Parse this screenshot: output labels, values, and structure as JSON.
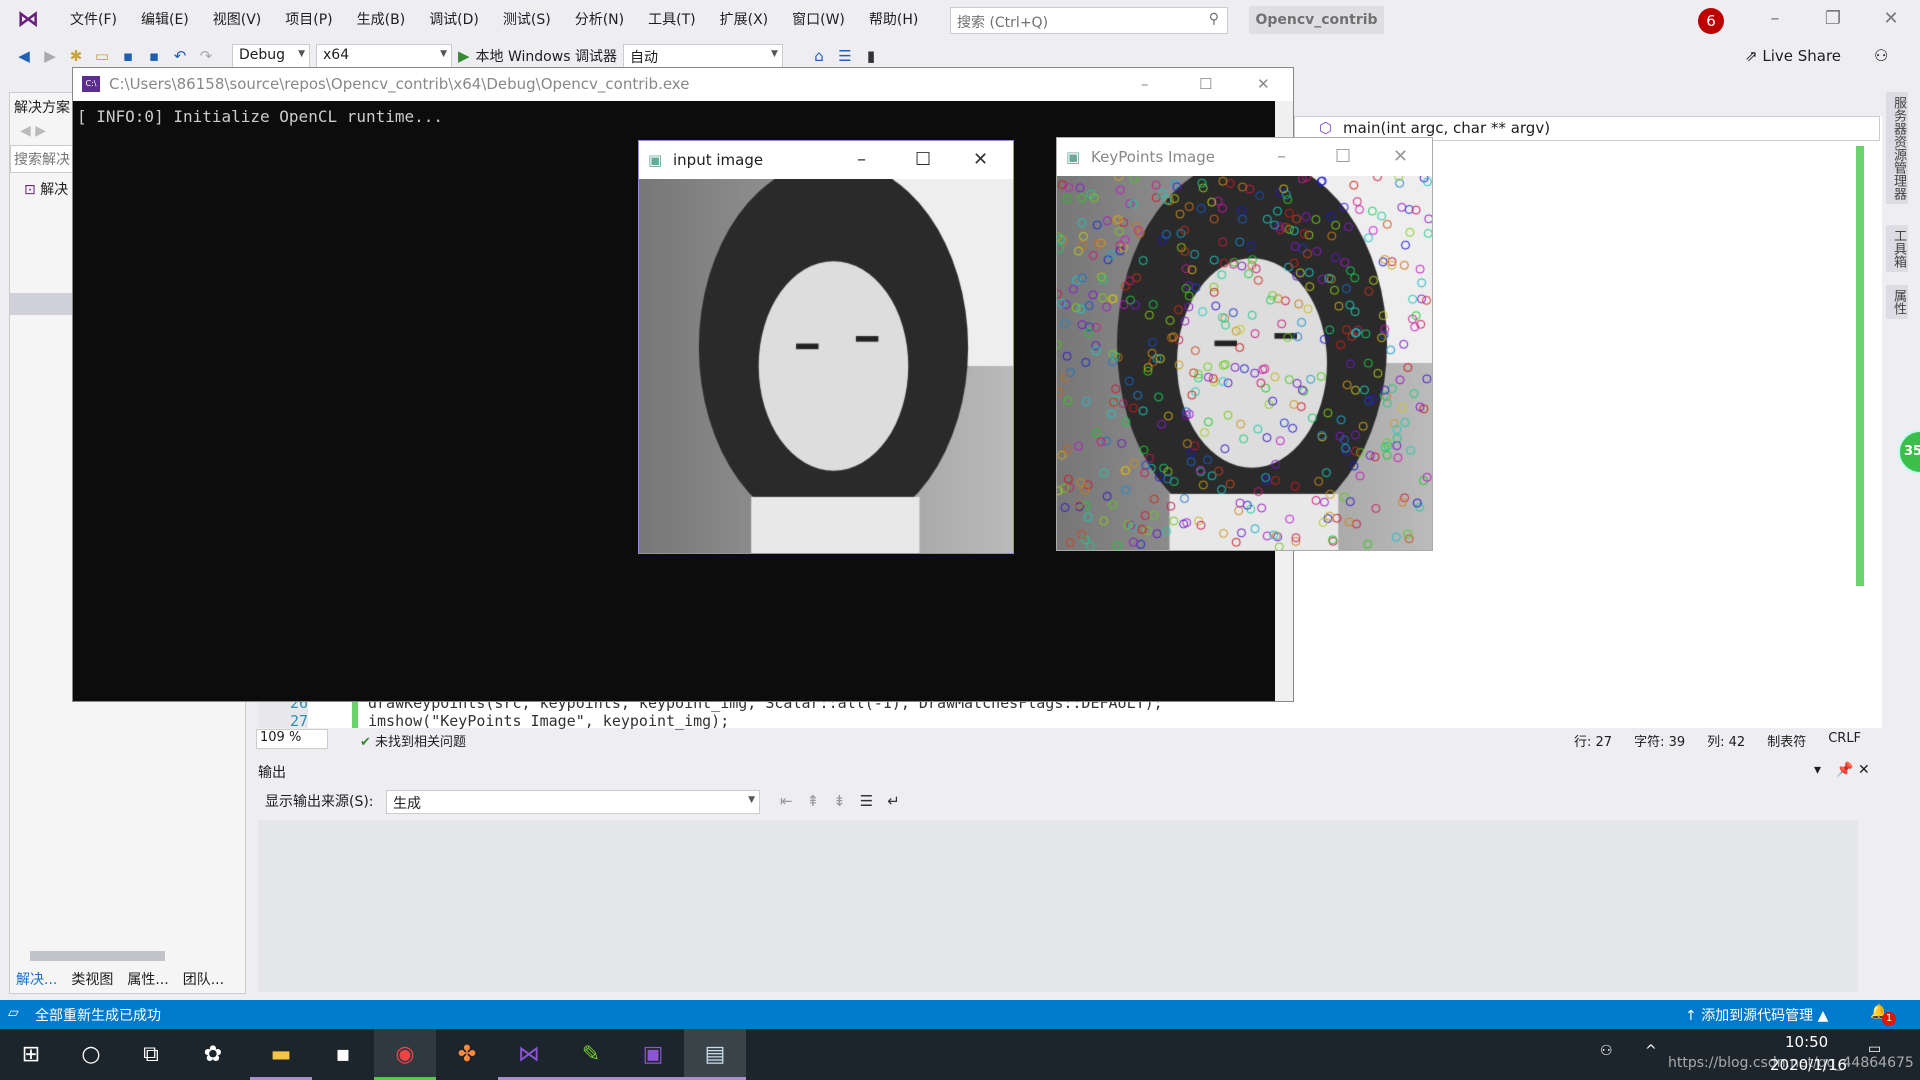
{
  "menubar": {
    "items": [
      "文件(F)",
      "编辑(E)",
      "视图(V)",
      "项目(P)",
      "生成(B)",
      "调试(D)",
      "测试(S)",
      "分析(N)",
      "工具(T)",
      "扩展(X)",
      "窗口(W)",
      "帮助(H)"
    ],
    "search_placeholder": "搜索 (Ctrl+Q)",
    "project_name": "Opencv_contrib",
    "notification_count": "6"
  },
  "toolbar": {
    "config": "Debug",
    "platform": "x64",
    "run_label": "本地 Windows 调试器",
    "auto": "自动",
    "live_share": "Live Share"
  },
  "solution_explorer": {
    "title": "解决方案",
    "search_placeholder": "搜索解决",
    "root": "解决",
    "tabs": [
      "解决...",
      "类视图",
      "属性...",
      "团队..."
    ]
  },
  "console": {
    "title": "C:\\Users\\86158\\source\\repos\\Opencv_contrib\\x64\\Debug\\Opencv_contrib.exe",
    "output": "[ INFO:0] Initialize OpenCL runtime..."
  },
  "input_window": {
    "title": "input image"
  },
  "keypoints_window": {
    "title": "KeyPoints Image"
  },
  "editor": {
    "function_nav": "main(int argc, char ** argv)",
    "lines": [
      {
        "num": "26",
        "code": "drawKeypoints(src, keypoints, keypoint_img, Scalar::all(-1), DrawMatchesFlags::DEFAULT);"
      },
      {
        "num": "27",
        "code": "imshow(\"KeyPoints Image\", keypoint_img);"
      }
    ],
    "zoom": "109 %",
    "issues": "未找到相关问题",
    "line": "行: 27",
    "char": "字符: 39",
    "col": "列: 42",
    "indent": "制表符",
    "eol": "CRLF"
  },
  "output": {
    "title": "输出",
    "source_label": "显示输出来源(S):",
    "source_value": "生成"
  },
  "right_tabs": [
    "服务器资源管理器",
    "工具箱",
    "属性"
  ],
  "perf_badge": "35",
  "statusbar": {
    "message": "全部重新生成已成功",
    "source_control": "添加到源代码管理",
    "notifications": "1"
  },
  "taskbar": {
    "time": "10:50",
    "date": "2020/1/16",
    "watermark": "https://blog.csdn.net/qq_44864675"
  }
}
